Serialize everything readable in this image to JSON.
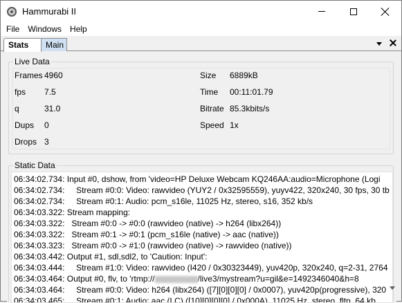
{
  "window": {
    "title": "Hammurabi II"
  },
  "menu": {
    "items": [
      "File",
      "Windows",
      "Help"
    ]
  },
  "tabs": [
    {
      "label": "Stats",
      "active": true
    },
    {
      "label": "Main",
      "active": false
    }
  ],
  "live": {
    "group_label": "Live Data",
    "left": [
      {
        "label": "Frames",
        "value": "4960"
      },
      {
        "label": "fps",
        "value": "7.5"
      },
      {
        "label": "q",
        "value": "31.0"
      },
      {
        "label": "Dups",
        "value": "0"
      },
      {
        "label": "Drops",
        "value": "3"
      }
    ],
    "right": [
      {
        "label": "Size",
        "value": "6889kB"
      },
      {
        "label": "Time",
        "value": "00:11:01.79"
      },
      {
        "label": "Bitrate",
        "value": "85.3kbits/s"
      },
      {
        "label": "Speed",
        "value": "1x"
      }
    ]
  },
  "static": {
    "group_label": "Static Data",
    "lines": [
      "06:34:02.734: Input #0, dshow, from 'video=HP Deluxe Webcam KQ246AA:audio=Microphone (Logi",
      "06:34:02.734:     Stream #0:0: Video: rawvideo (YUY2 / 0x32595559), yuyv422, 320x240, 30 fps, 30 tb",
      "06:34:02.734:     Stream #0:1: Audio: pcm_s16le, 11025 Hz, stereo, s16, 352 kb/s",
      "06:34:03.322: Stream mapping:",
      "06:34:03.322:   Stream #0:0 -> #0:0 (rawvideo (native) -> h264 (libx264))",
      "06:34:03.322:   Stream #0:1 -> #0:1 (pcm_s16le (native) -> aac (native))",
      "06:34:03.323:   Stream #0:0 -> #1:0 (rawvideo (native) -> rawvideo (native))",
      "06:34:03.442: Output #1, sdl,sdl2, to 'Caution: Input':",
      "06:34:03.444:     Stream #1:0: Video: rawvideo (I420 / 0x30323449), yuv420p, 320x240, q=2-31, 2764",
      "06:34:03.464: Output #0, flv, to 'rtmp://",
      "06:34:03.464:     Stream #0:0: Video: h264 (libx264) ([7][0][0][0] / 0x0007), yuv420p(progressive), 320",
      "06:34:03.465:     Stream #0:1: Audio: aac (LC) ([10][0][0][0] / 0x000A), 11025 Hz, stereo, fltp, 64 kb"
    ],
    "line10_tail": "/live3/mystream?u=gil&e=1492346040&h=8"
  }
}
